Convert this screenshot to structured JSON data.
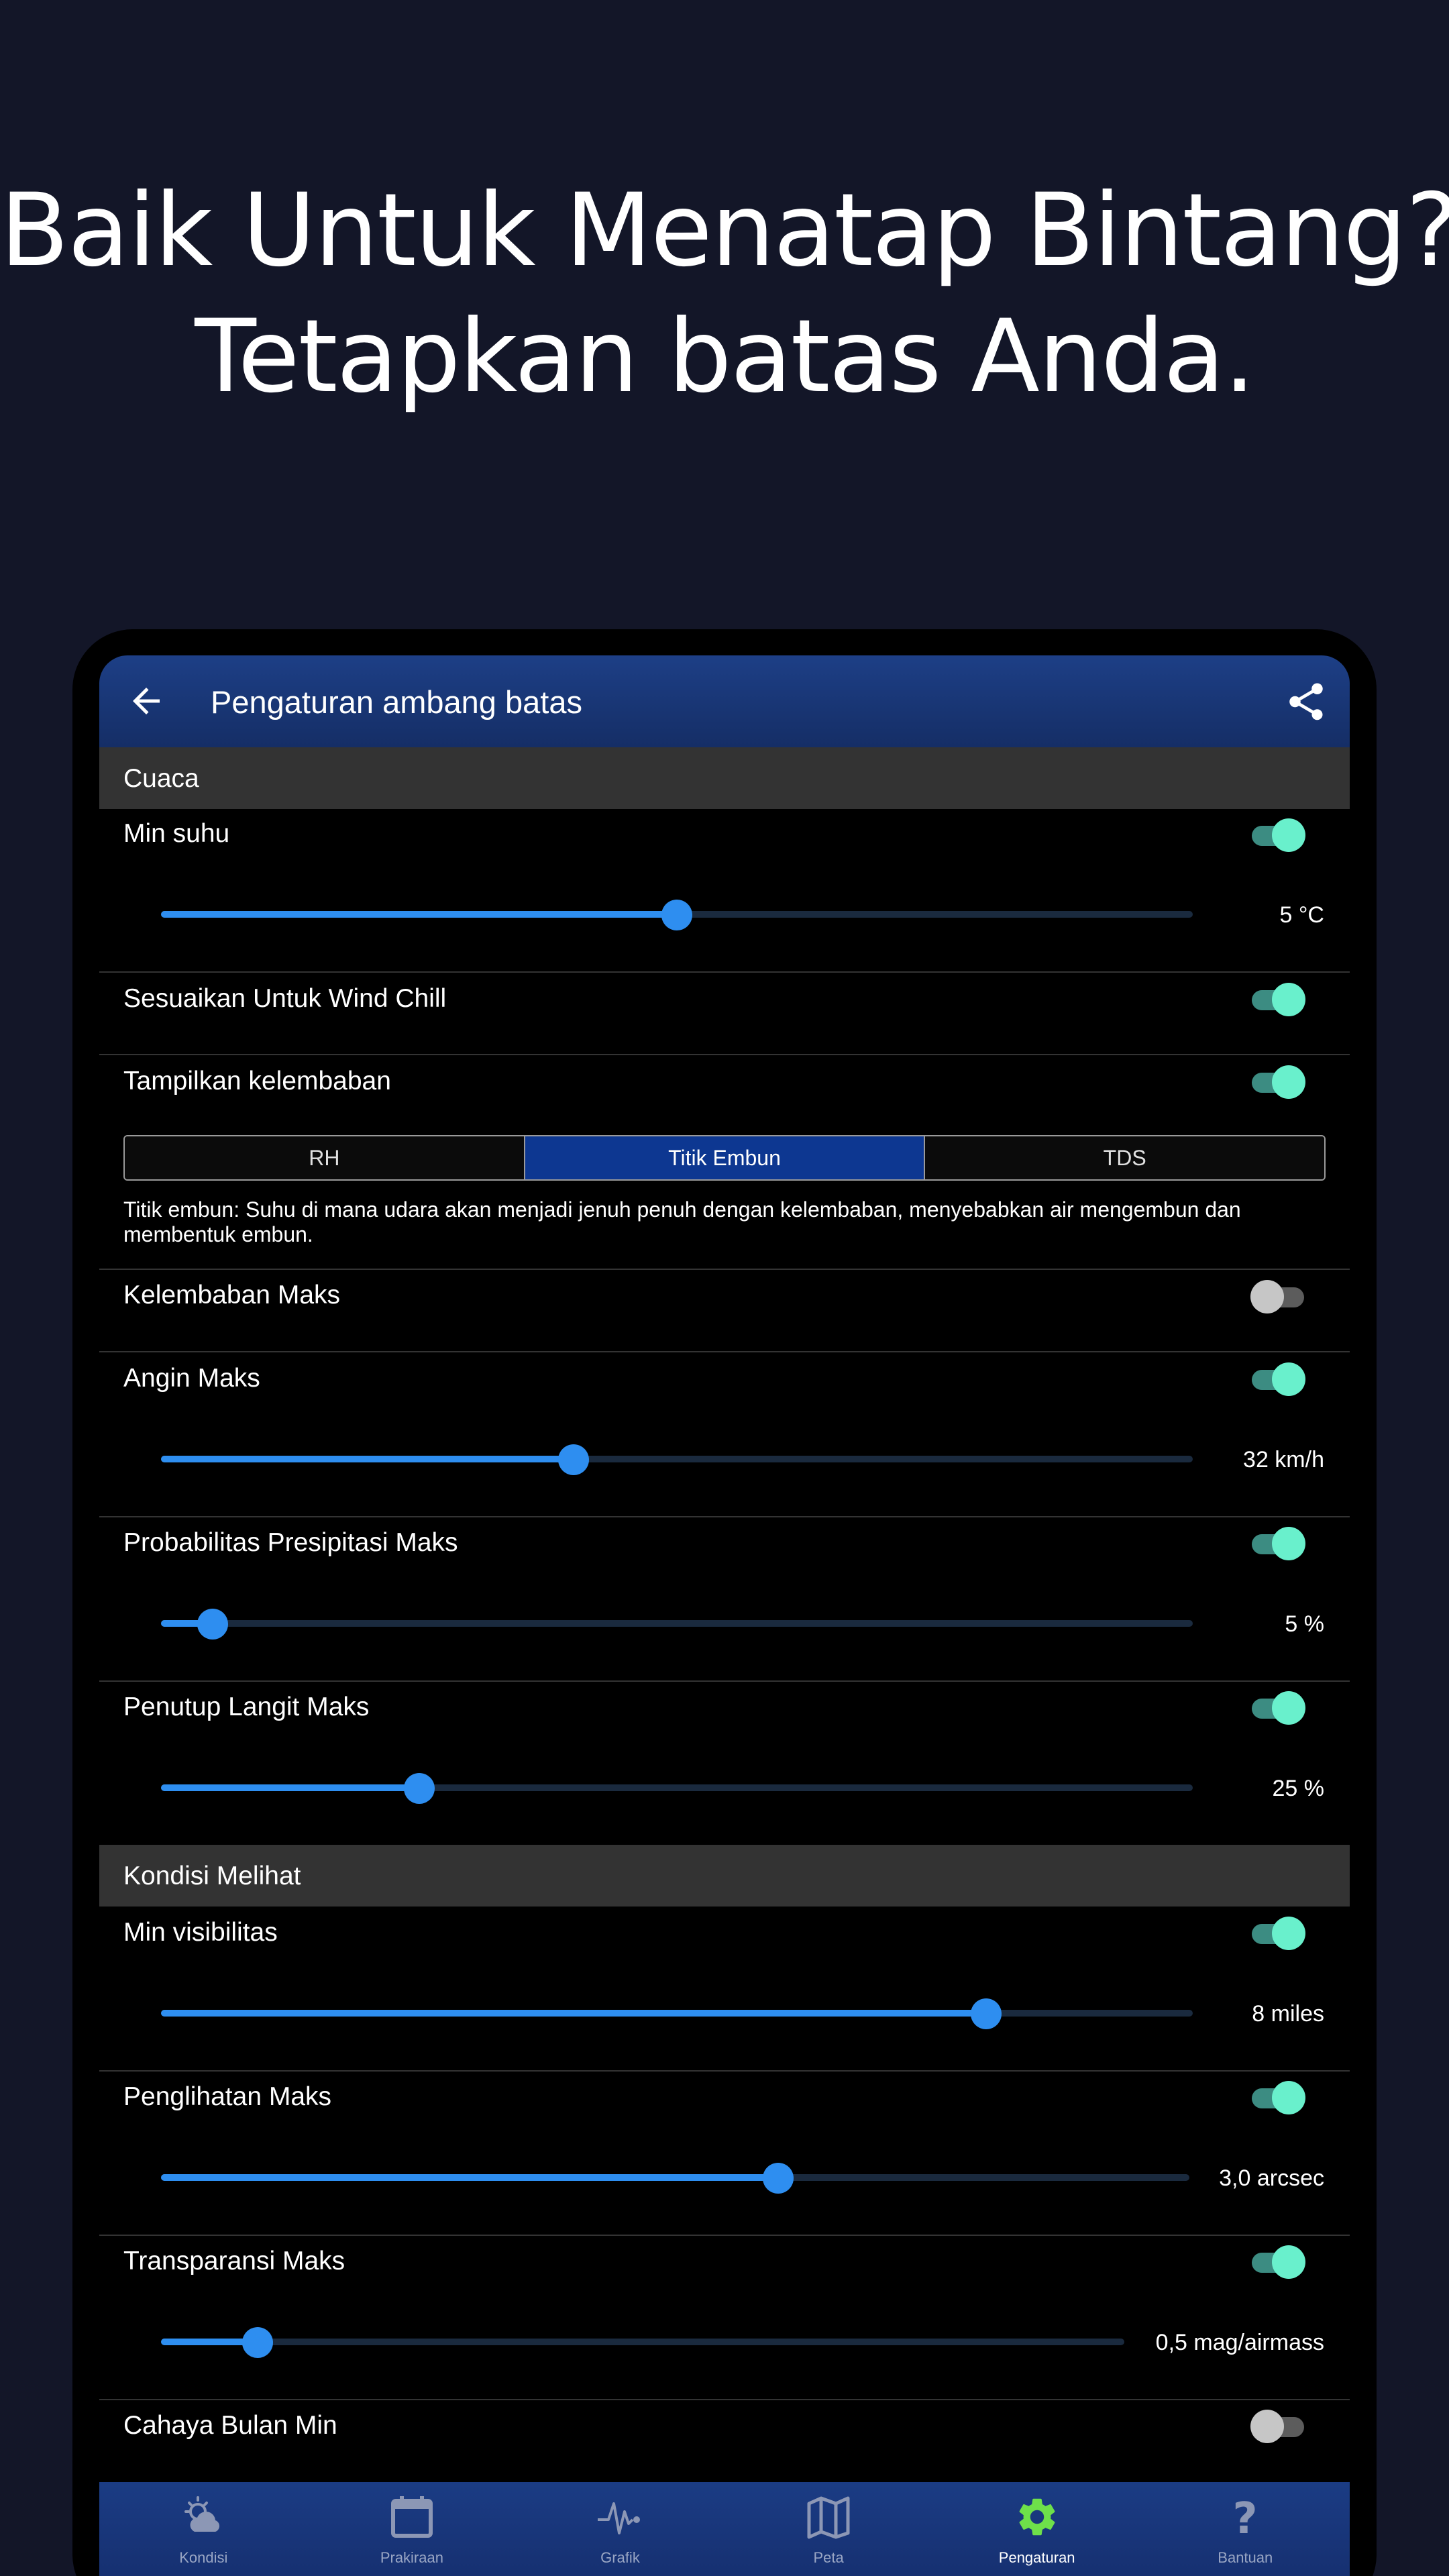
{
  "headline": {
    "line1": "Baik Untuk Menatap Bintang?",
    "line2": "Tetapkan batas Anda."
  },
  "appbar": {
    "title": "Pengaturan ambang batas",
    "back_icon": "arrow-left-icon",
    "share_icon": "share-icon"
  },
  "sections": {
    "weather": "Cuaca",
    "viewing": "Kondisi Melihat"
  },
  "settings": {
    "min_temp": {
      "label": "Min suhu",
      "enabled": true,
      "value": "5 °C",
      "level": 0.5
    },
    "wind_chill": {
      "label": "Sesuaikan Untuk Wind Chill",
      "enabled": true
    },
    "humidity_display": {
      "label": "Tampilkan kelembaban",
      "enabled": true,
      "options": [
        "RH",
        "Titik Embun",
        "TDS"
      ],
      "selected": "Titik Embun",
      "description": "Titik embun: Suhu di mana udara akan menjadi jenuh penuh dengan kelembaban, menyebabkan air mengembun dan membentuk embun."
    },
    "max_humidity": {
      "label": "Kelembaban Maks",
      "enabled": false
    },
    "max_wind": {
      "label": "Angin Maks",
      "enabled": true,
      "value": "32 km/h",
      "level": 0.4
    },
    "max_precip": {
      "label": "Probabilitas Presipitasi Maks",
      "enabled": true,
      "value": "5 %",
      "level": 0.05
    },
    "max_cloud": {
      "label": "Penutup Langit Maks",
      "enabled": true,
      "value": "25 %",
      "level": 0.25
    },
    "min_visibility": {
      "label": "Min visibilitas",
      "enabled": true,
      "value": "8 miles",
      "level": 0.8
    },
    "max_seeing": {
      "label": "Penglihatan Maks",
      "enabled": true,
      "value": "3,0 arcsec",
      "level": 0.6
    },
    "max_transparency": {
      "label": "Transparansi Maks",
      "enabled": true,
      "value": "0,5 mag/airmass",
      "level": 0.1
    },
    "min_moonlight": {
      "label": "Cahaya Bulan Min",
      "enabled": false
    }
  },
  "colors": {
    "background": "#131628",
    "appbar": "#1d3f86",
    "accent_slider": "#2e8ef0",
    "toggle_on": "#69f0cc",
    "nav_active_icon": "#6ee04a"
  },
  "bottom_nav": [
    {
      "label": "Kondisi",
      "icon": "weather-cloud-sun-icon",
      "active": false
    },
    {
      "label": "Prakiraan",
      "icon": "calendar-icon",
      "active": false
    },
    {
      "label": "Grafik",
      "icon": "pulse-chart-icon",
      "active": false
    },
    {
      "label": "Peta",
      "icon": "map-icon",
      "active": false
    },
    {
      "label": "Pengaturan",
      "icon": "gear-icon",
      "active": true
    },
    {
      "label": "Bantuan",
      "icon": "question-mark-icon",
      "active": false
    }
  ]
}
